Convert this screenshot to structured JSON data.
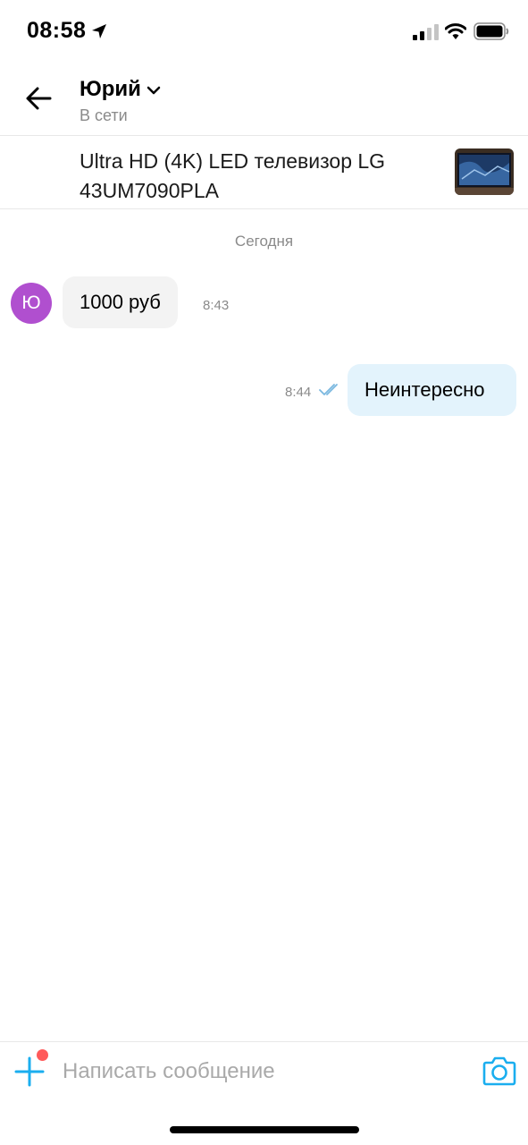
{
  "status_bar": {
    "time": "08:58",
    "icons": [
      "location-arrow-icon",
      "cellular-signal-icon",
      "wifi-icon",
      "battery-icon"
    ]
  },
  "header": {
    "back_icon": "arrow-left-icon",
    "contact_name": "Юрий",
    "dropdown_icon": "chevron-down-icon",
    "contact_status": "В сети"
  },
  "listing": {
    "title": "Ultra HD (4K) LED телевизор LG 43UM7090PLA",
    "thumbnail": "tv-photo-thumbnail"
  },
  "chat": {
    "date_separator": "Сегодня",
    "messages": [
      {
        "direction": "incoming",
        "avatar_letter": "Ю",
        "text": "1000 руб",
        "time": "8:43"
      },
      {
        "direction": "outgoing",
        "text": "Неинтересно",
        "time": "8:44",
        "status_icon": "double-check-icon"
      }
    ]
  },
  "composer": {
    "add_icon": "plus-icon",
    "placeholder": "Написать сообщение",
    "value": "",
    "camera_icon": "camera-icon"
  },
  "colors": {
    "accent": "#1aaeef",
    "avatar": "#b04fcf",
    "incoming_bubble": "#f3f3f3",
    "outgoing_bubble": "#e3f3fc",
    "notification_dot": "#ff5a5a",
    "secondary_text": "#8a8a8a"
  }
}
